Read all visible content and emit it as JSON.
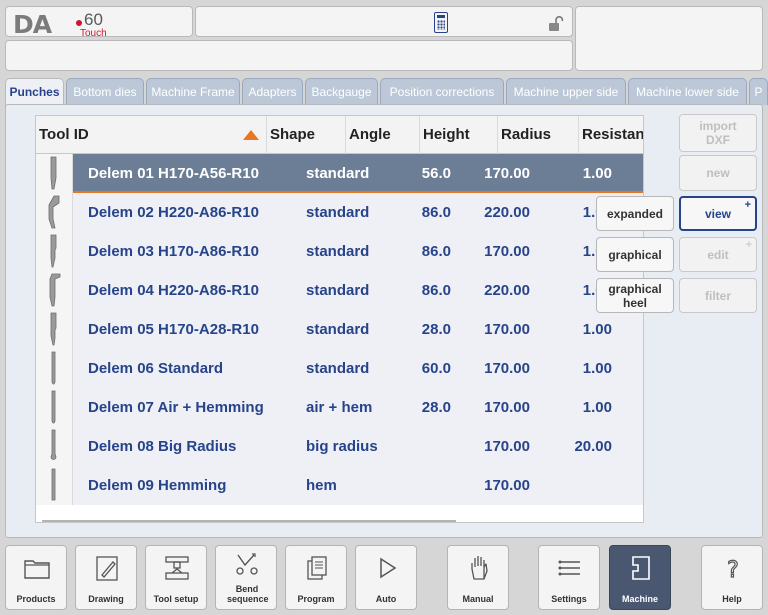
{
  "logo": {
    "brand": "DA",
    "model": "60",
    "edition": "Touch"
  },
  "top": {
    "calculator_icon": "calculator-icon",
    "lock_icon": "unlocked-padlock-icon"
  },
  "tabs": [
    {
      "label": "Punches",
      "active": true
    },
    {
      "label": "Bottom dies"
    },
    {
      "label": "Machine Frame"
    },
    {
      "label": "Adapters"
    },
    {
      "label": "Backgauge"
    },
    {
      "label": "Position corrections"
    },
    {
      "label": "Machine upper side"
    },
    {
      "label": "Machine lower side"
    },
    {
      "label": "P"
    }
  ],
  "table": {
    "columns": [
      "Tool ID",
      "Shape",
      "Angle",
      "Height",
      "Radius",
      "Resistan"
    ],
    "sort": {
      "column": "Tool ID",
      "direction": "ascending"
    },
    "rows": [
      {
        "id": "Delem 01 H170-A56-R10",
        "shape": "standard",
        "angle": "56.0",
        "height": "170.00",
        "radius": "1.00",
        "selected": true
      },
      {
        "id": "Delem 02 H220-A86-R10",
        "shape": "standard",
        "angle": "86.0",
        "height": "220.00",
        "radius": "1.00"
      },
      {
        "id": "Delem 03 H170-A86-R10",
        "shape": "standard",
        "angle": "86.0",
        "height": "170.00",
        "radius": "1.00"
      },
      {
        "id": "Delem 04 H220-A86-R10",
        "shape": "standard",
        "angle": "86.0",
        "height": "220.00",
        "radius": "1.00"
      },
      {
        "id": "Delem 05 H170-A28-R10",
        "shape": "standard",
        "angle": "28.0",
        "height": "170.00",
        "radius": "1.00"
      },
      {
        "id": "Delem 06 Standard",
        "shape": "standard",
        "angle": "60.0",
        "height": "170.00",
        "radius": "1.00"
      },
      {
        "id": "Delem 07 Air + Hemming",
        "shape": "air + hem",
        "angle": "28.0",
        "height": "170.00",
        "radius": "1.00"
      },
      {
        "id": "Delem 08 Big Radius",
        "shape": "big radius",
        "angle": "",
        "height": "170.00",
        "radius": "20.00"
      },
      {
        "id": "Delem 09 Hemming",
        "shape": "hem",
        "angle": "",
        "height": "170.00",
        "radius": ""
      }
    ]
  },
  "view_buttons": {
    "expanded": "expanded",
    "graphical": "graphical",
    "graphical_heel": "graphical heel"
  },
  "side_buttons": {
    "import_dxf": "import DXF",
    "new": "new",
    "view": "view",
    "edit": "edit",
    "filter": "filter"
  },
  "function_keys": [
    {
      "label": "Products",
      "icon": "folder-icon"
    },
    {
      "label": "Drawing",
      "icon": "pencil-drawing-icon"
    },
    {
      "label": "Tool setup",
      "icon": "tool-setup-icon"
    },
    {
      "label": "Bend sequence",
      "icon": "bend-sequence-icon"
    },
    {
      "label": "Program",
      "icon": "program-pages-icon"
    },
    {
      "label": "Auto",
      "icon": "play-icon"
    },
    {
      "label": "Manual",
      "icon": "hand-icon"
    },
    {
      "label": "Settings",
      "icon": "settings-list-icon"
    },
    {
      "label": "Machine",
      "icon": "machine-icon",
      "active": true
    },
    {
      "label": "Help",
      "icon": "help-icon"
    }
  ],
  "colors": {
    "accent": "#27448a",
    "selection": "#6c7d96",
    "sort_arrow": "#e87722",
    "logo_red": "#d0142c"
  }
}
